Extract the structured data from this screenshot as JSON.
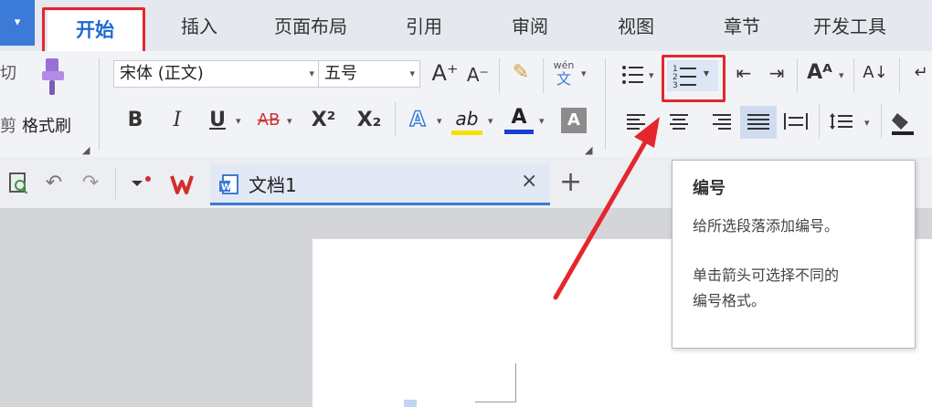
{
  "app_menu": {
    "arrow": "▾"
  },
  "tabs": [
    {
      "label": "开始"
    },
    {
      "label": "插入"
    },
    {
      "label": "页面布局"
    },
    {
      "label": "引用"
    },
    {
      "label": "审阅"
    },
    {
      "label": "视图"
    },
    {
      "label": "章节"
    },
    {
      "label": "开发工具"
    }
  ],
  "ribbon": {
    "clip_partial": "切",
    "cut_partial": "剪",
    "format_painter_label": "格式刷",
    "font_name": "宋体 (正文)",
    "font_size": "五号",
    "bold": "B",
    "italic": "I",
    "underline": "U",
    "strikethrough": "AB",
    "superscript": "X²",
    "subscript": "X₂",
    "phonetic_top": "wén",
    "phonetic_bottom": "文",
    "grow_font": "A⁺",
    "shrink_font": "A⁻",
    "text_effect": "A",
    "highlight": "ab",
    "font_color": "A",
    "char_shading": "A"
  },
  "doc_tabs": {
    "tab_label": "文档1",
    "close": "×",
    "new_tab": "+"
  },
  "tooltip": {
    "title": "编号",
    "line1": "给所选段落添加编号。",
    "line2": "单击箭头可选择不同的",
    "line3": "编号格式。"
  },
  "colors": {
    "accent_blue": "#3b7ad6",
    "annotation_red": "#e3272d",
    "highlight_yellow": "#f5e000",
    "font_color_blue": "#1a3fd1"
  }
}
